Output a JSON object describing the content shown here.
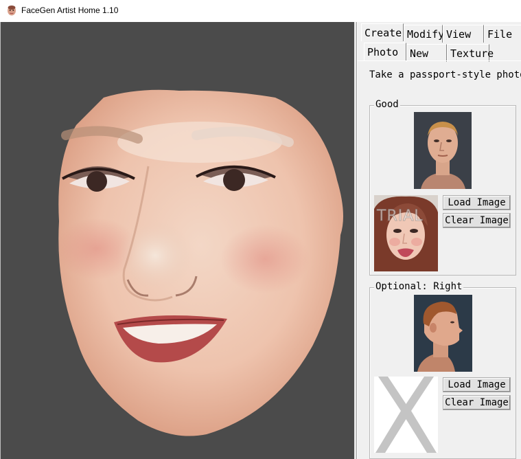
{
  "window": {
    "title": "FaceGen Artist Home 1.10",
    "icon": "face-app-icon"
  },
  "tabs": {
    "main": [
      {
        "label": "Create",
        "active": true
      },
      {
        "label": "Modify",
        "active": false
      },
      {
        "label": "View",
        "active": false
      },
      {
        "label": "File",
        "active": false
      }
    ],
    "sub": [
      {
        "label": "Photo",
        "active": true
      },
      {
        "label": "New",
        "active": false
      },
      {
        "label": "Texture",
        "active": false
      }
    ]
  },
  "photo": {
    "instruction": "Take a passport-style photo ind",
    "good": {
      "label": "Good",
      "example_image": "frontal-portrait-example",
      "user_image": "loaded-frontal-photo",
      "watermark": "TRIAL",
      "load_label": "Load Image",
      "clear_label": "Clear Image"
    },
    "optional_right": {
      "label": "Optional: Right",
      "example_image": "right-profile-example",
      "user_image": "empty-placeholder-x",
      "load_label": "Load Image",
      "clear_label": "Clear Image"
    }
  },
  "colors": {
    "viewport_bg": "#4b4b4b",
    "panel_bg": "#f0f0f0",
    "button_bg": "#e1e1e1",
    "placeholder_x": "#c4c4c4"
  }
}
